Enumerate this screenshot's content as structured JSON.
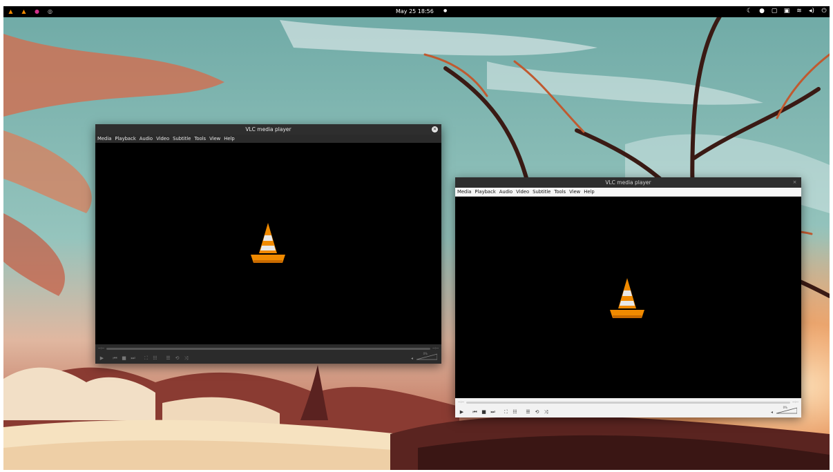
{
  "topbar": {
    "apps": [
      "vlc-icon",
      "vlc-icon",
      "app-icon",
      "chrome-icon"
    ],
    "clock": "May 25  18:56",
    "indicator": "●",
    "tray": [
      "night-light-icon",
      "notification-icon",
      "clipboard-icon",
      "screen-icon",
      "wifi-icon",
      "volume-icon",
      "power-icon"
    ]
  },
  "windows": [
    {
      "title": "VLC media player",
      "close": "×",
      "menu": [
        "Media",
        "Playback",
        "Audio",
        "Video",
        "Subtitle",
        "Tools",
        "View",
        "Help"
      ],
      "time_elapsed": "--:--",
      "time_total": "--:--",
      "volume": "0%"
    },
    {
      "title": "VLC media player",
      "close": "×",
      "menu": [
        "Media",
        "Playback",
        "Audio",
        "Video",
        "Subtitle",
        "Tools",
        "View",
        "Help"
      ],
      "time_elapsed": "--:--",
      "time_total": "--:--",
      "volume": "0%"
    }
  ],
  "colors": {
    "vlc_orange": "#f08a00",
    "dark_bg": "#2b2b2b",
    "light_bg": "#f2f2f2"
  }
}
